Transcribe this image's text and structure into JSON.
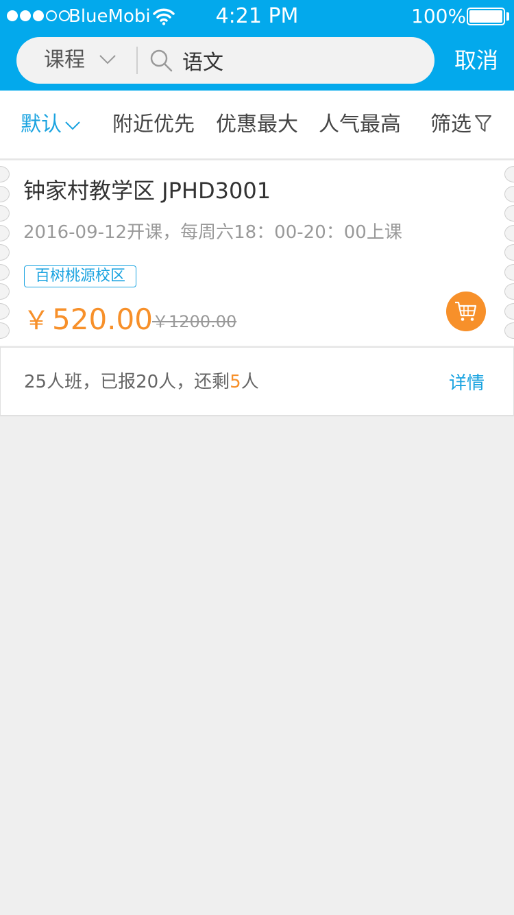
{
  "status_bar": {
    "carrier": "BlueMobi",
    "time": "4:21 PM",
    "battery": "100%",
    "icons": [
      "signal-dots-icon",
      "wifi-icon",
      "battery-icon"
    ]
  },
  "header": {
    "type_select": "课程",
    "search_value": "语文",
    "cancel_label": "取消"
  },
  "filters": {
    "default_label": "默认",
    "nearby_label": "附近优先",
    "discount_label": "优惠最大",
    "popular_label": "人气最高",
    "filter_label": "筛选"
  },
  "course": {
    "title": "钟家村教学区 JPHD3001",
    "schedule": "2016-09-12开课，每周六18：00-20：00上课",
    "campus": "百树桃源校区",
    "price_symbol": "￥",
    "price": "520.00",
    "original_price": "￥1200.00",
    "enroll_prefix": "25人班，已报20人，还剩",
    "remaining": "5",
    "enroll_suffix": "人",
    "detail_label": "详情"
  },
  "colors": {
    "brand": "#03a9ec",
    "accent_blue": "#1aa3e0",
    "price_orange": "#f7902a",
    "background": "#efefef"
  }
}
